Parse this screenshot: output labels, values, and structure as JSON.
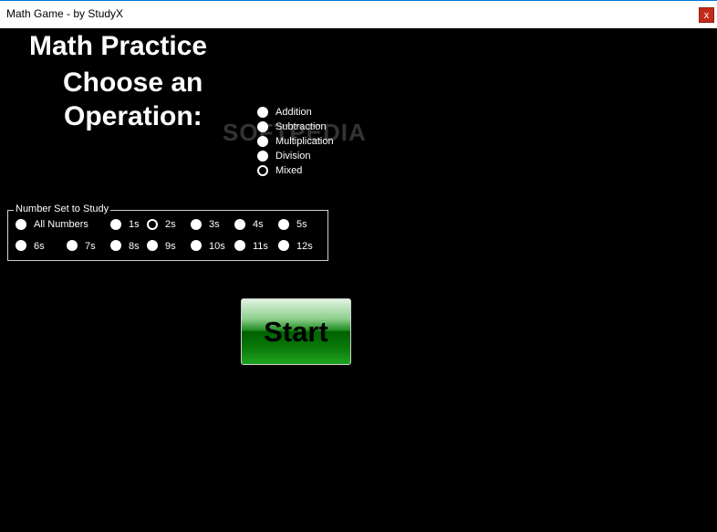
{
  "window": {
    "title": "Math Game - by StudyX",
    "close_label": "x"
  },
  "headings": {
    "line1": "Math Practice",
    "line2": "Choose an",
    "line3": "Operation:"
  },
  "watermark": "SOFTPEDIA",
  "operations": [
    {
      "label": "Addition",
      "checked": false
    },
    {
      "label": "Subtraction",
      "checked": false
    },
    {
      "label": "Multiplication",
      "checked": false
    },
    {
      "label": "Division",
      "checked": false
    },
    {
      "label": "Mixed",
      "checked": true
    }
  ],
  "number_set": {
    "legend": "Number Set to Study",
    "row1": [
      {
        "label": "All Numbers",
        "checked": false
      },
      {
        "label": "1s",
        "checked": false
      },
      {
        "label": "2s",
        "checked": true
      },
      {
        "label": "3s",
        "checked": false
      },
      {
        "label": "4s",
        "checked": false
      },
      {
        "label": "5s",
        "checked": false
      }
    ],
    "row2": [
      {
        "label": "6s",
        "checked": false
      },
      {
        "label": "7s",
        "checked": false
      },
      {
        "label": "8s",
        "checked": false
      },
      {
        "label": "9s",
        "checked": false
      },
      {
        "label": "10s",
        "checked": false
      },
      {
        "label": "11s",
        "checked": false
      },
      {
        "label": "12s",
        "checked": false
      }
    ]
  },
  "start_label": "Start",
  "colors": {
    "background": "#000000",
    "text": "#ffffff",
    "button_green": "#0a7a0a",
    "close_red": "#c42b1c"
  }
}
